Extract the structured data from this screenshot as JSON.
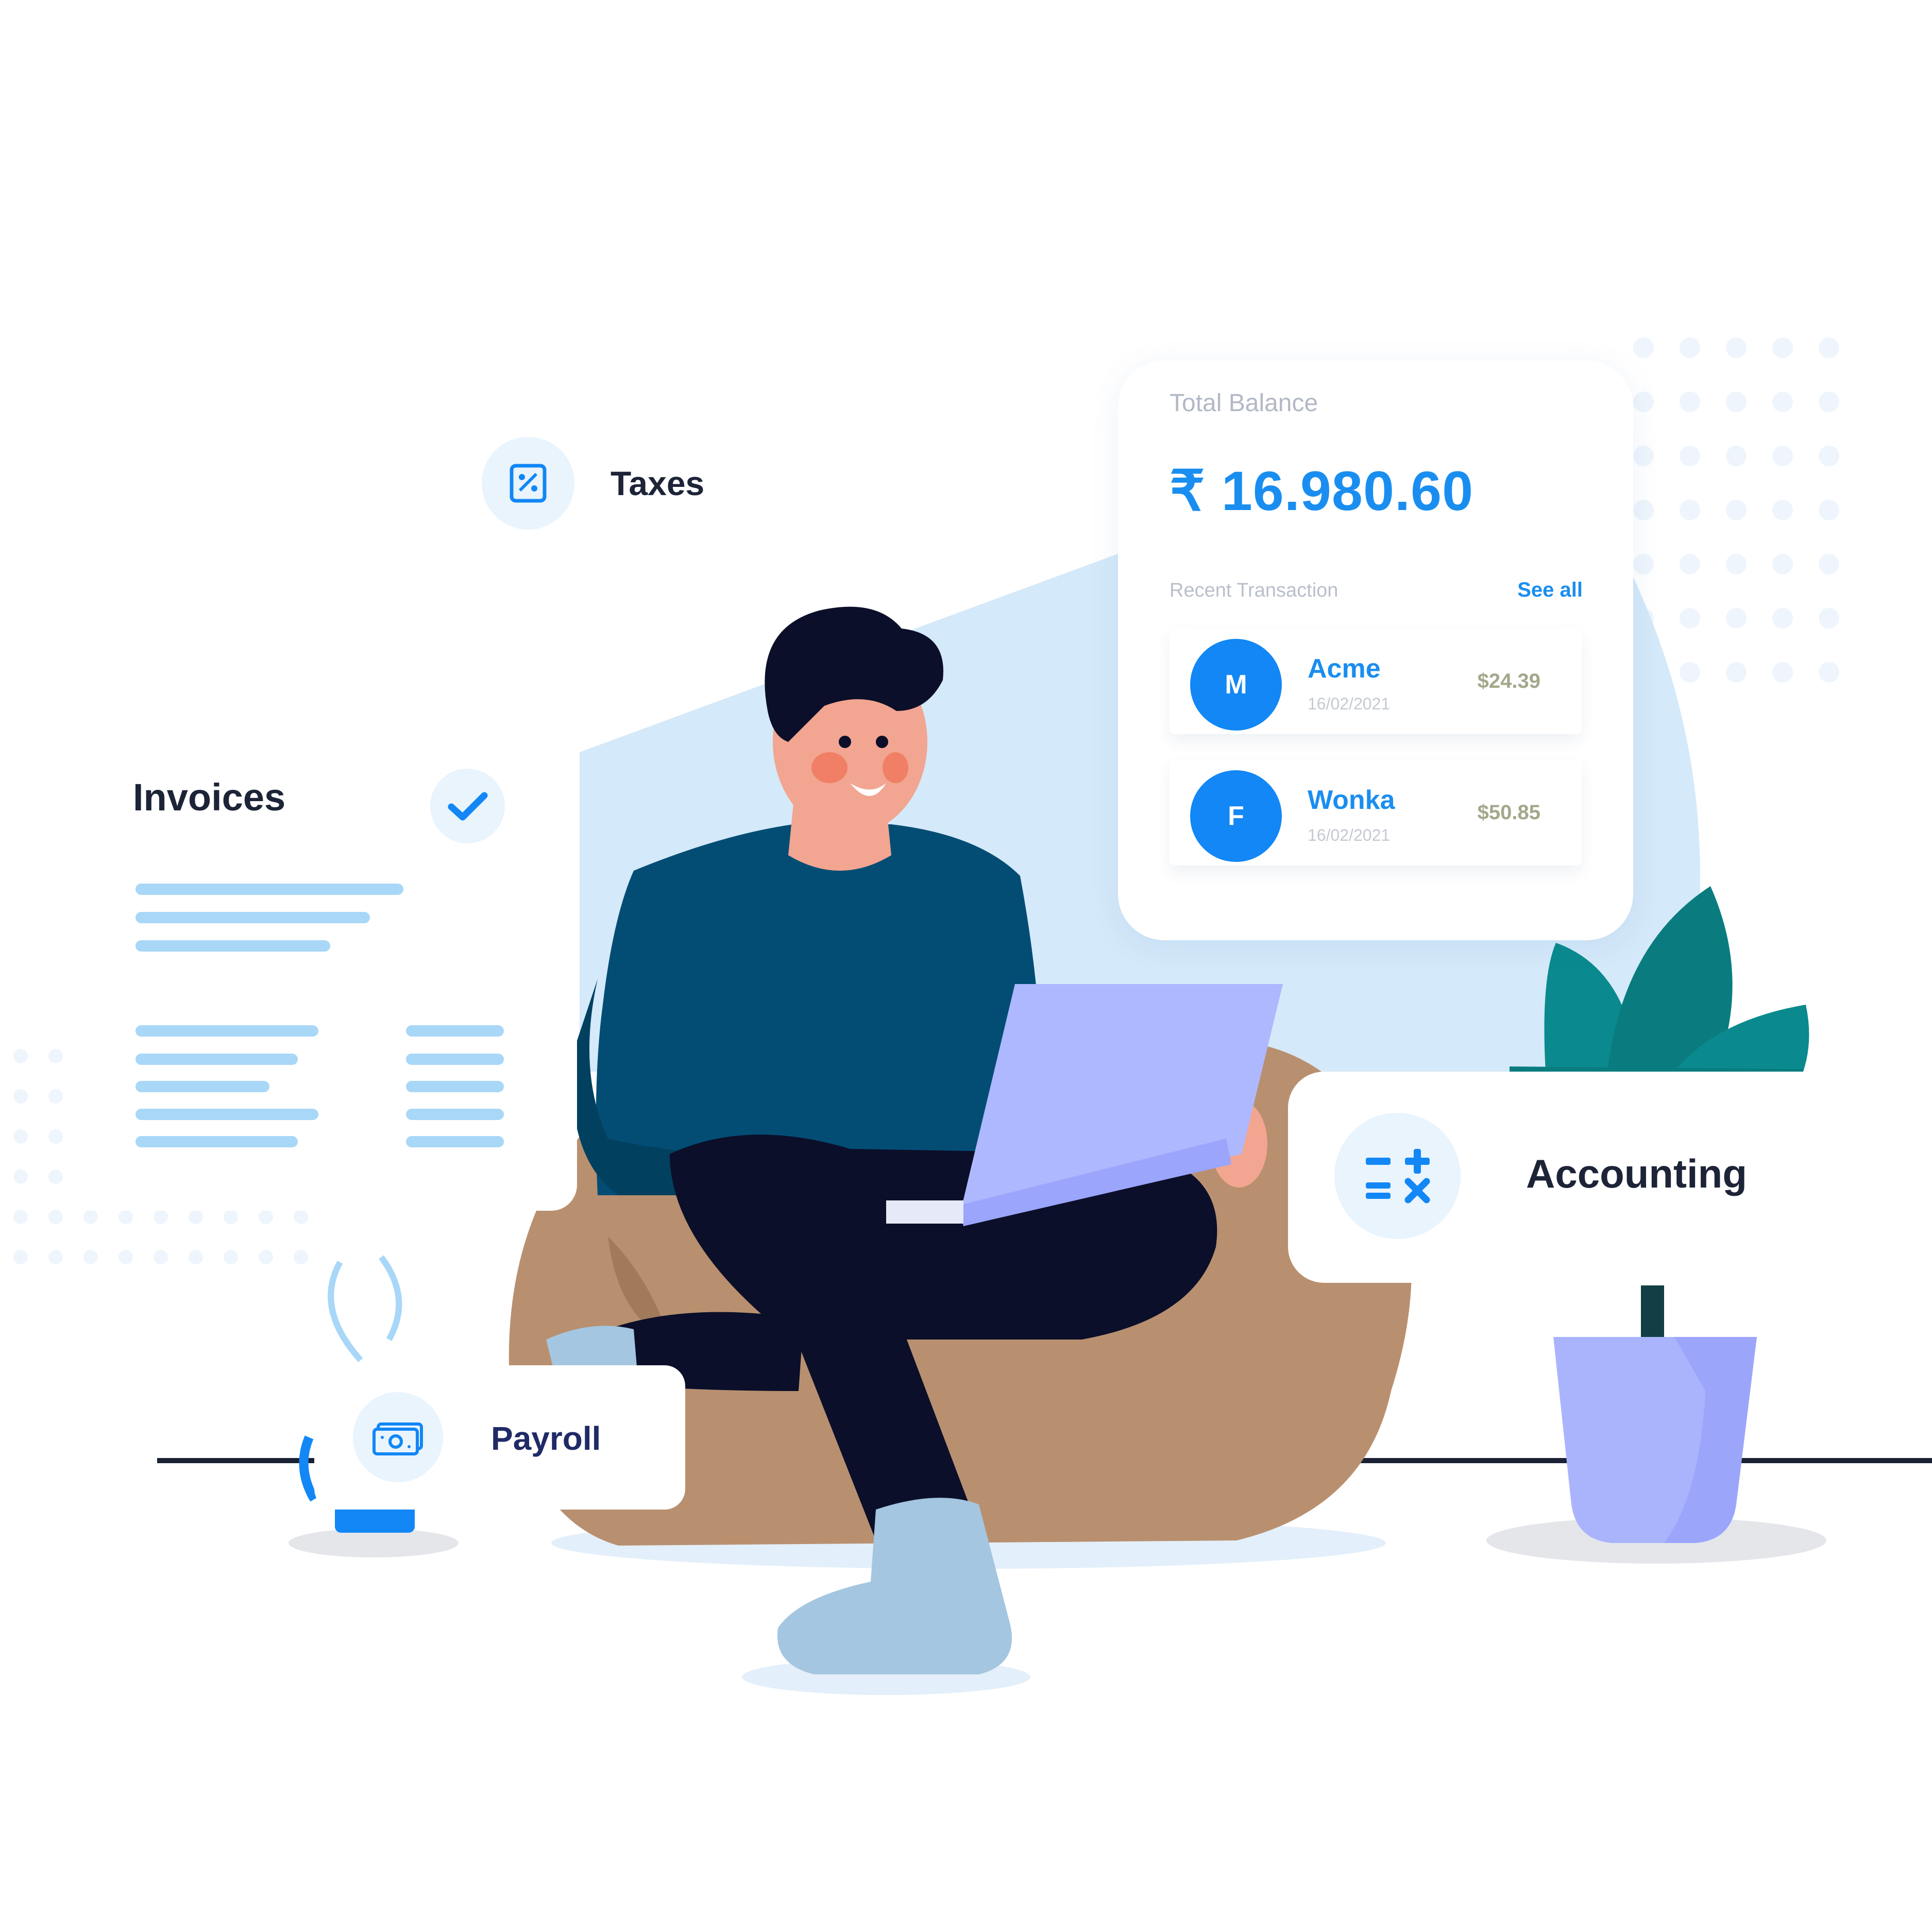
{
  "taxes": {
    "label": "Taxes",
    "icon": "percent-receipt-icon"
  },
  "invoices": {
    "label": "Invoices",
    "icon": "checkmark-icon"
  },
  "payroll": {
    "label": "Payroll",
    "icon": "cash-icon"
  },
  "accounting": {
    "label": "Accounting",
    "icon": "calculator-symbols-icon"
  },
  "balance": {
    "title": "Total Balance",
    "amount": "₹ 16.980.60",
    "recent_label": "Recent Transaction",
    "see_all": "See all",
    "transactions": [
      {
        "initial": "M",
        "name": "Acme",
        "date": "16/02/2021",
        "amount": "$24.39"
      },
      {
        "initial": "F",
        "name": "Wonka",
        "date": "16/02/2021",
        "amount": "$50.85"
      }
    ]
  },
  "colors": {
    "accent": "#1a8ef0",
    "avatar": "#1287f5",
    "light_blue_bg": "#d4e9f9",
    "sweater": "#034d75",
    "pants": "#0b0f29",
    "beanbag": "#b89070",
    "laptop": "#aeb8fe",
    "plant": "#0a8a8e",
    "pot": "#aab4fd"
  }
}
